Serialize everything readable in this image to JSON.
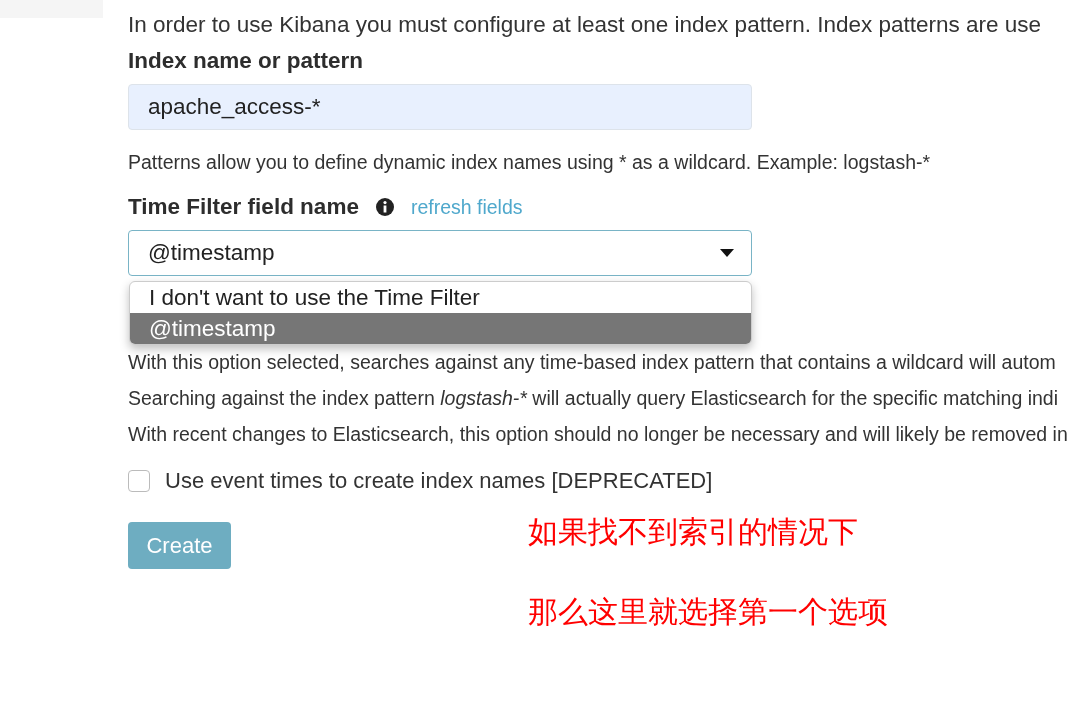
{
  "intro": "In order to use Kibana you must configure at least one index pattern. Index patterns are use",
  "index_field": {
    "label": "Index name or pattern",
    "value": "apache_access-*",
    "help": "Patterns allow you to define dynamic index names using * as a wildcard. Example: logstash-*"
  },
  "time_field": {
    "label": "Time Filter field name",
    "link": "refresh fields",
    "value": "@timestamp",
    "expanded": true,
    "options": [
      {
        "label": "I don't want to use the Time Filter",
        "selected": false
      },
      {
        "label": "@timestamp",
        "selected": true
      }
    ]
  },
  "notes": [
    {
      "text": "With this option selected, searches against any time-based index pattern that contains a wildcard will autom"
    },
    {
      "text": "Searching against the index pattern ",
      "term": "logstash-*",
      "rest": " will actually query Elasticsearch for the specific matching indi"
    },
    {
      "text": "With recent changes to Elasticsearch, this option should no longer be necessary and will likely be removed in"
    }
  ],
  "checkbox": {
    "label": "Use event times to create index names [DEPRECATED]",
    "checked": false
  },
  "create_button": "Create",
  "annotations": [
    "如果找不到索引的情况下",
    "那么这里就选择第一个选项"
  ]
}
